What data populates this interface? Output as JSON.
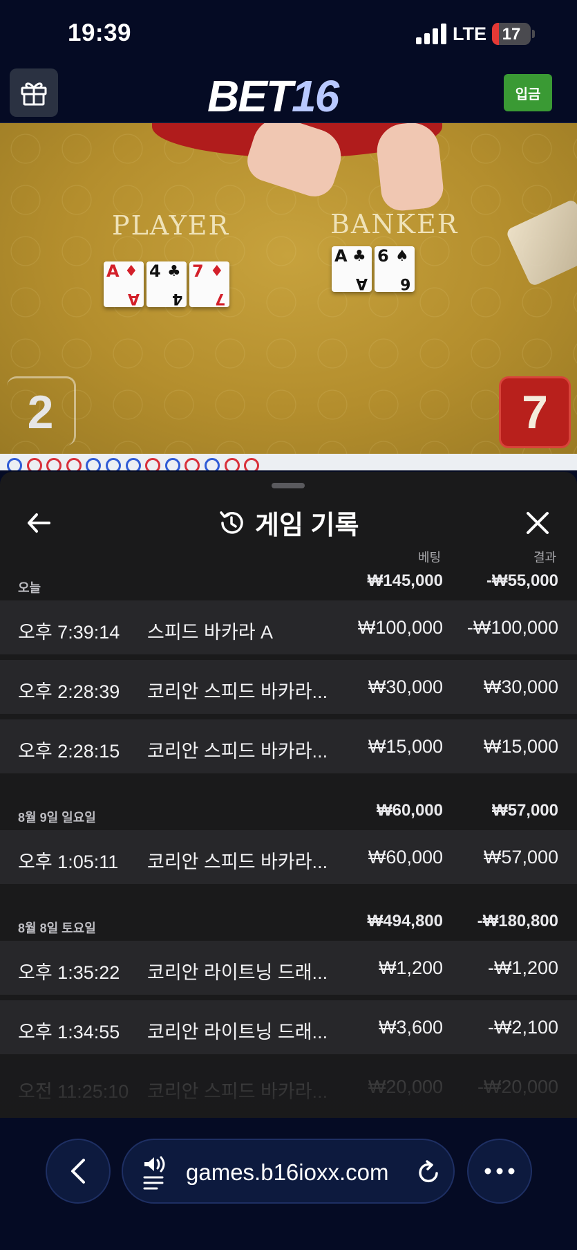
{
  "status_bar": {
    "time": "19:39",
    "network": "LTE",
    "battery": "17",
    "battery_level": 0.17
  },
  "header": {
    "logo_main": "BET",
    "logo_num": "16",
    "deposit_label": "입금"
  },
  "video": {
    "player_label": "PLAYER",
    "banker_label": "BANKER",
    "player_score": "2",
    "banker_score": "7",
    "player_cards": [
      {
        "rank": "A",
        "suit": "♦",
        "color": "red"
      },
      {
        "rank": "4",
        "suit": "♣",
        "color": "black"
      },
      {
        "rank": "7",
        "suit": "♦",
        "color": "red"
      }
    ],
    "banker_cards": [
      {
        "rank": "A",
        "suit": "♣",
        "color": "black"
      },
      {
        "rank": "6",
        "suit": "♠",
        "color": "black"
      }
    ]
  },
  "sheet": {
    "title": "게임 기록",
    "col_bet": "베팅",
    "col_result": "결과",
    "groups": [
      {
        "date": "오늘",
        "bet": "₩145,000",
        "result": "-₩55,000",
        "rows": [
          {
            "time": "오후 7:39:14",
            "game": "스피드 바카라 A",
            "bet": "₩100,000",
            "result": "-₩100,000"
          },
          {
            "time": "오후 2:28:39",
            "game": "코리안 스피드 바카라...",
            "bet": "₩30,000",
            "result": "₩30,000"
          },
          {
            "time": "오후 2:28:15",
            "game": "코리안 스피드 바카라...",
            "bet": "₩15,000",
            "result": "₩15,000"
          }
        ]
      },
      {
        "date": "8월 9일 일요일",
        "bet": "₩60,000",
        "result": "₩57,000",
        "rows": [
          {
            "time": "오후 1:05:11",
            "game": "코리안 스피드 바카라...",
            "bet": "₩60,000",
            "result": "₩57,000"
          }
        ]
      },
      {
        "date": "8월 8일 토요일",
        "bet": "₩494,800",
        "result": "-₩180,800",
        "rows": [
          {
            "time": "오후 1:35:22",
            "game": "코리안 라이트닝 드래...",
            "bet": "₩1,200",
            "result": "-₩1,200"
          },
          {
            "time": "오후 1:34:55",
            "game": "코리안 라이트닝 드래...",
            "bet": "₩3,600",
            "result": "-₩2,100"
          },
          {
            "time": "오전 11:25:10",
            "game": "코리안 스피드 바카라...",
            "bet": "₩20,000",
            "result": "-₩20,000"
          }
        ]
      }
    ]
  },
  "browser": {
    "url": "games.b16ioxx.com"
  },
  "colors": {
    "background": "#050b24",
    "deposit": "#3a9a34",
    "banker_red": "#b8201c",
    "sheet": "#1a1a1b",
    "row": "#27272a"
  },
  "icons": [
    "gift-icon",
    "history-icon",
    "back-arrow-icon",
    "close-icon",
    "chevron-left-icon",
    "speaker-icon",
    "reload-icon",
    "more-icon"
  ]
}
